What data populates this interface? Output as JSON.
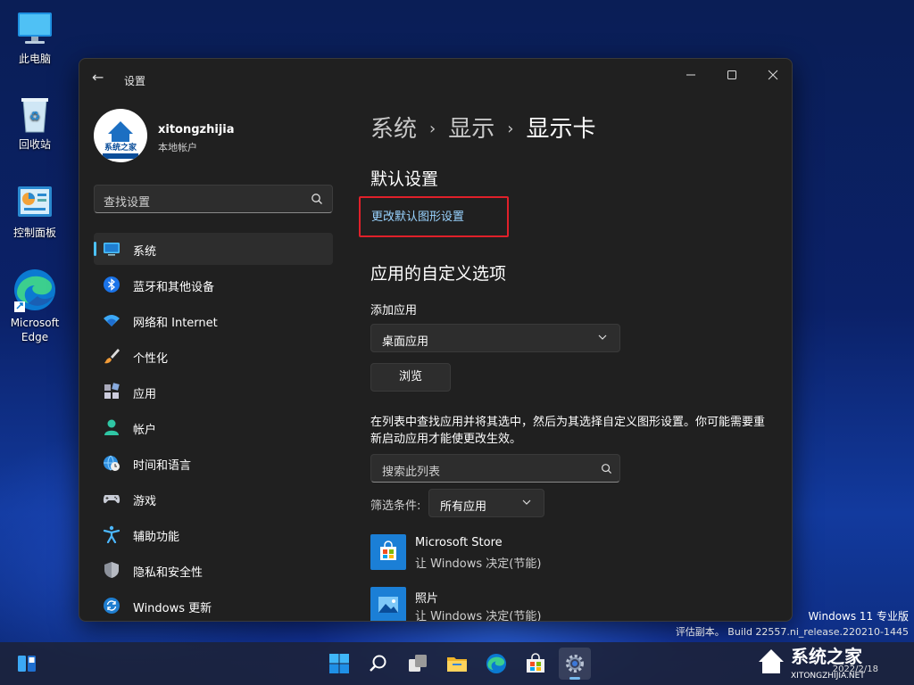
{
  "desktop": {
    "icons": [
      {
        "label": "此电脑",
        "icon": "computer-icon"
      },
      {
        "label": "回收站",
        "icon": "recycle-bin-icon"
      },
      {
        "label": "控制面板",
        "icon": "control-panel-icon"
      },
      {
        "label": "Microsoft Edge",
        "icon": "edge-icon"
      }
    ]
  },
  "window": {
    "title": "设置",
    "controls": [
      "minimize",
      "maximize",
      "close"
    ]
  },
  "user": {
    "name": "xitongzhijia",
    "account_type": "本地帐户",
    "avatar_text": "系统之家"
  },
  "search": {
    "placeholder": "查找设置"
  },
  "sidebar": {
    "items": [
      {
        "label": "系统",
        "icon": "monitor-icon",
        "active": true
      },
      {
        "label": "蓝牙和其他设备",
        "icon": "bluetooth-icon"
      },
      {
        "label": "网络和 Internet",
        "icon": "wifi-icon"
      },
      {
        "label": "个性化",
        "icon": "brush-icon"
      },
      {
        "label": "应用",
        "icon": "apps-icon"
      },
      {
        "label": "帐户",
        "icon": "person-icon"
      },
      {
        "label": "时间和语言",
        "icon": "globe-clock-icon"
      },
      {
        "label": "游戏",
        "icon": "gamepad-icon"
      },
      {
        "label": "辅助功能",
        "icon": "accessibility-icon"
      },
      {
        "label": "隐私和安全性",
        "icon": "shield-icon"
      },
      {
        "label": "Windows 更新",
        "icon": "update-icon"
      }
    ]
  },
  "breadcrumb": {
    "items": [
      "系统",
      "显示",
      "显示卡"
    ],
    "separator": "›"
  },
  "content": {
    "default_section_title": "默认设置",
    "default_graphics_link": "更改默认图形设置",
    "custom_section_title": "应用的自定义选项",
    "add_app_label": "添加应用",
    "app_type_selected": "桌面应用",
    "browse_button": "浏览",
    "description": "在列表中查找应用并将其选中，然后为其选择自定义图形设置。你可能需要重新启动应用才能使更改生效。",
    "list_search_placeholder": "搜索此列表",
    "filter_label": "筛选条件:",
    "filter_selected": "所有应用",
    "apps": [
      {
        "name": "Microsoft Store",
        "status": "让 Windows 决定(节能)",
        "icon": "store-icon"
      },
      {
        "name": "照片",
        "status": "让 Windows 决定(节能)",
        "icon": "photos-icon"
      }
    ]
  },
  "watermark": {
    "edition": "Windows 11 专业版",
    "build": "评估副本。 Build 22557.ni_release.220210-1445",
    "date": "2022/2/18",
    "site_logo": "系统之家",
    "site_url": "XITONGZHIJIA.NET"
  },
  "taskbar": {
    "items": [
      "widgets-icon",
      "start-icon",
      "search-icon",
      "task-view-icon",
      "file-explorer-icon",
      "edge-icon",
      "store-icon",
      "settings-icon"
    ],
    "active": "settings-icon"
  },
  "colors": {
    "accent": "#4cc2ff",
    "link": "#99d3ff",
    "highlight_box": "#e0202a",
    "window_bg": "#202020"
  }
}
